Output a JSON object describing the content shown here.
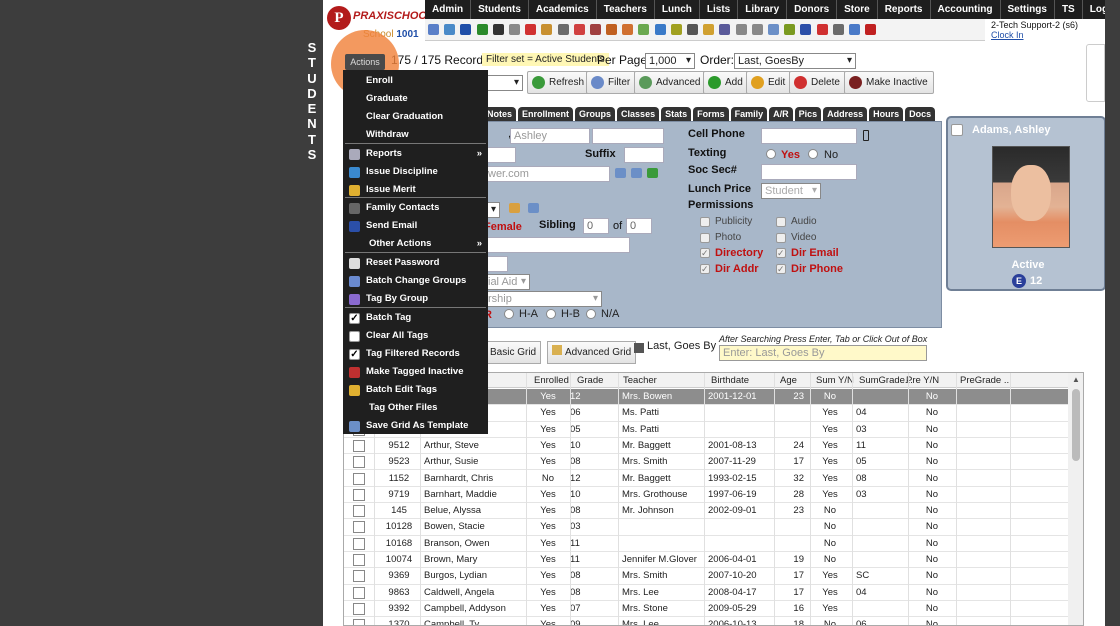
{
  "side_label": [
    "S",
    "T",
    "U",
    "D",
    "E",
    "N",
    "T",
    "S"
  ],
  "logo": {
    "brand": "PRAXISCHOOL",
    "school_prefix": "School",
    "school_number": "1001"
  },
  "topnav": [
    "Admin",
    "Students",
    "Academics",
    "Teachers",
    "Lunch",
    "Lists",
    "Library",
    "Donors",
    "Store",
    "Reports",
    "Accounting",
    "Settings",
    "TS",
    "Logout"
  ],
  "user": {
    "name": "2-Tech Support-2 (s6)",
    "link": "Clock In"
  },
  "actions_label": "Actions",
  "records": "175 / 175 Records",
  "filter_set": "Filter set = Active Students",
  "per_page_label": "Per Page:",
  "per_page_value": "1,000",
  "order_label": "Order:",
  "order_value": "Last, GoesBy",
  "buttons": {
    "refresh": "Refresh",
    "filter": "Filter",
    "advanced": "Advanced",
    "add": "Add",
    "edit": "Edit",
    "delete": "Delete",
    "make_inactive": "Make Inactive"
  },
  "tabs": [
    "Notes",
    "Enrollment",
    "Groups",
    "Classes",
    "Stats",
    "Forms",
    "Family",
    "A/R",
    "Pics",
    "Address",
    "Hours",
    "Docs"
  ],
  "form": {
    "first_name": "Ashley",
    "suffix_label": "Suffix",
    "email_partial": "wer.com",
    "gender": "Female",
    "sibling_label": "Sibling",
    "sibling_value": "0",
    "sibling_of": "of",
    "sibling_total": "0",
    "financial_aid": "ial Aid",
    "scholarship": "rship",
    "options": {
      "r": "R",
      "ha": "H-A",
      "hb": "H-B",
      "na": "N/A"
    },
    "cell_phone_label": "Cell Phone",
    "texting_label": "Texting",
    "texting_yes": "Yes",
    "texting_no": "No",
    "soc_sec_label": "Soc Sec#",
    "lunch_price_label": "Lunch Price",
    "lunch_price_value": "Student",
    "permissions_label": "Permissions",
    "permissions": [
      {
        "label": "Publicity",
        "checked": false
      },
      {
        "label": "Audio",
        "checked": false
      },
      {
        "label": "Photo",
        "checked": false
      },
      {
        "label": "Video",
        "checked": false
      },
      {
        "label": "Directory",
        "checked": true
      },
      {
        "label": "Dir Email",
        "checked": true
      },
      {
        "label": "Dir Addr",
        "checked": true
      },
      {
        "label": "Dir Phone",
        "checked": true
      }
    ]
  },
  "card": {
    "name": "Adams, Ashley",
    "status": "Active",
    "grade": "12",
    "badge": "E"
  },
  "grid_tools": {
    "basic": "Basic Grid",
    "advanced": "Advanced Grid",
    "sort": "Last, Goes By",
    "hint": "After Searching Press Enter, Tab or Click Out of Box",
    "search_placeholder": "Enter: Last, Goes By"
  },
  "columns": [
    "Enrolled",
    "Grade",
    "Teacher",
    "Birthdate",
    "Age",
    "Sum Y/N",
    "SumGrade...",
    "Pre Y/N",
    "PreGrade ..."
  ],
  "rows": [
    {
      "id": "",
      "name": "",
      "enrolled": "Yes",
      "grade": "12",
      "teacher": "Mrs. Bowen",
      "birthdate": "2001-12-01",
      "age": "23",
      "sum": "No",
      "sumgrade": "",
      "pre": "No"
    },
    {
      "id": "",
      "name": "",
      "enrolled": "Yes",
      "grade": "06",
      "teacher": "Ms. Patti",
      "birthdate": "",
      "age": "",
      "sum": "Yes",
      "sumgrade": "04",
      "pre": "No"
    },
    {
      "id": "",
      "name": "",
      "enrolled": "Yes",
      "grade": "05",
      "teacher": "Ms. Patti",
      "birthdate": "",
      "age": "",
      "sum": "Yes",
      "sumgrade": "03",
      "pre": "No"
    },
    {
      "id": "9512",
      "name": "Arthur, Steve",
      "enrolled": "Yes",
      "grade": "10",
      "teacher": "Mr. Baggett",
      "birthdate": "2001-08-13",
      "age": "24",
      "sum": "Yes",
      "sumgrade": "11",
      "pre": "No"
    },
    {
      "id": "9523",
      "name": "Arthur, Susie",
      "enrolled": "Yes",
      "grade": "08",
      "teacher": "Mrs. Smith",
      "birthdate": "2007-11-29",
      "age": "17",
      "sum": "Yes",
      "sumgrade": "05",
      "pre": "No"
    },
    {
      "id": "1152",
      "name": "Barnhardt, Chris",
      "enrolled": "No",
      "grade": "12",
      "teacher": "Mr. Baggett",
      "birthdate": "1993-02-15",
      "age": "32",
      "sum": "Yes",
      "sumgrade": "08",
      "pre": "No"
    },
    {
      "id": "9719",
      "name": "Barnhart, Maddie",
      "enrolled": "Yes",
      "grade": "10",
      "teacher": "Mrs. Grothouse",
      "birthdate": "1997-06-19",
      "age": "28",
      "sum": "Yes",
      "sumgrade": "03",
      "pre": "No"
    },
    {
      "id": "145",
      "name": "Belue, Alyssa",
      "enrolled": "Yes",
      "grade": "08",
      "teacher": "Mr. Johnson",
      "birthdate": "2002-09-01",
      "age": "23",
      "sum": "No",
      "sumgrade": "",
      "pre": "No"
    },
    {
      "id": "10128",
      "name": "Bowen, Stacie",
      "enrolled": "Yes",
      "grade": "03",
      "teacher": "",
      "birthdate": "",
      "age": "",
      "sum": "No",
      "sumgrade": "",
      "pre": "No"
    },
    {
      "id": "10168",
      "name": "Branson, Owen",
      "enrolled": "Yes",
      "grade": "11",
      "teacher": "",
      "birthdate": "",
      "age": "",
      "sum": "No",
      "sumgrade": "",
      "pre": "No"
    },
    {
      "id": "10074",
      "name": "Brown, Mary",
      "enrolled": "Yes",
      "grade": "11",
      "teacher": "Jennifer M.Glover",
      "birthdate": "2006-04-01",
      "age": "19",
      "sum": "No",
      "sumgrade": "",
      "pre": "No"
    },
    {
      "id": "9369",
      "name": "Burgos, Lydian",
      "enrolled": "Yes",
      "grade": "08",
      "teacher": "Mrs. Smith",
      "birthdate": "2007-10-20",
      "age": "17",
      "sum": "Yes",
      "sumgrade": "SC",
      "pre": "No"
    },
    {
      "id": "9863",
      "name": "Caldwell, Angela",
      "enrolled": "Yes",
      "grade": "08",
      "teacher": "Mrs. Lee",
      "birthdate": "2008-04-17",
      "age": "17",
      "sum": "Yes",
      "sumgrade": "04",
      "pre": "No"
    },
    {
      "id": "9392",
      "name": "Campbell, Addyson",
      "enrolled": "Yes",
      "grade": "07",
      "teacher": "Mrs. Stone",
      "birthdate": "2009-05-29",
      "age": "16",
      "sum": "Yes",
      "sumgrade": "",
      "pre": "No"
    },
    {
      "id": "1370",
      "name": "Campbell, Ty",
      "enrolled": "Yes",
      "grade": "09",
      "teacher": "Mrs. Lee",
      "birthdate": "2006-10-13",
      "age": "18",
      "sum": "No",
      "sumgrade": "06",
      "pre": "No"
    }
  ],
  "menu": [
    {
      "label": "Enroll",
      "icon": "",
      "arrow": false
    },
    {
      "label": "Graduate",
      "icon": "",
      "arrow": false
    },
    {
      "label": "Clear Graduation",
      "icon": "",
      "arrow": false
    },
    {
      "label": "Withdraw",
      "icon": "",
      "arrow": false
    },
    {
      "label": "Reports",
      "icon": "printer-icon",
      "arrow": true
    },
    {
      "label": "Issue Discipline",
      "icon": "pin-icon",
      "arrow": false
    },
    {
      "label": "Issue Merit",
      "icon": "award-icon",
      "arrow": false
    },
    {
      "label": "Family Contacts",
      "icon": "phone-icon",
      "arrow": false
    },
    {
      "label": "Send Email",
      "icon": "globe-icon",
      "arrow": false
    },
    {
      "label": "Other Actions",
      "icon": "",
      "arrow": true
    },
    {
      "label": "Reset Password",
      "icon": "password-icon",
      "arrow": false
    },
    {
      "label": "Batch Change Groups",
      "icon": "groups-icon",
      "arrow": false
    },
    {
      "label": "Tag By Group",
      "icon": "tag-group-icon",
      "arrow": false
    },
    {
      "label": "Batch Tag",
      "icon": "checkbox-checked-icon",
      "arrow": false
    },
    {
      "label": "Clear All Tags",
      "icon": "checkbox-empty-icon",
      "arrow": false
    },
    {
      "label": "Tag Filtered Records",
      "icon": "checkbox-checked-icon",
      "arrow": false
    },
    {
      "label": "Make Tagged Inactive",
      "icon": "inactive-icon",
      "arrow": false
    },
    {
      "label": "Batch Edit Tags",
      "icon": "pencil-icon",
      "arrow": false
    },
    {
      "label": "Tag Other Files",
      "icon": "",
      "arrow": false
    },
    {
      "label": "Save Grid As Template",
      "icon": "template-icon",
      "arrow": false
    }
  ]
}
